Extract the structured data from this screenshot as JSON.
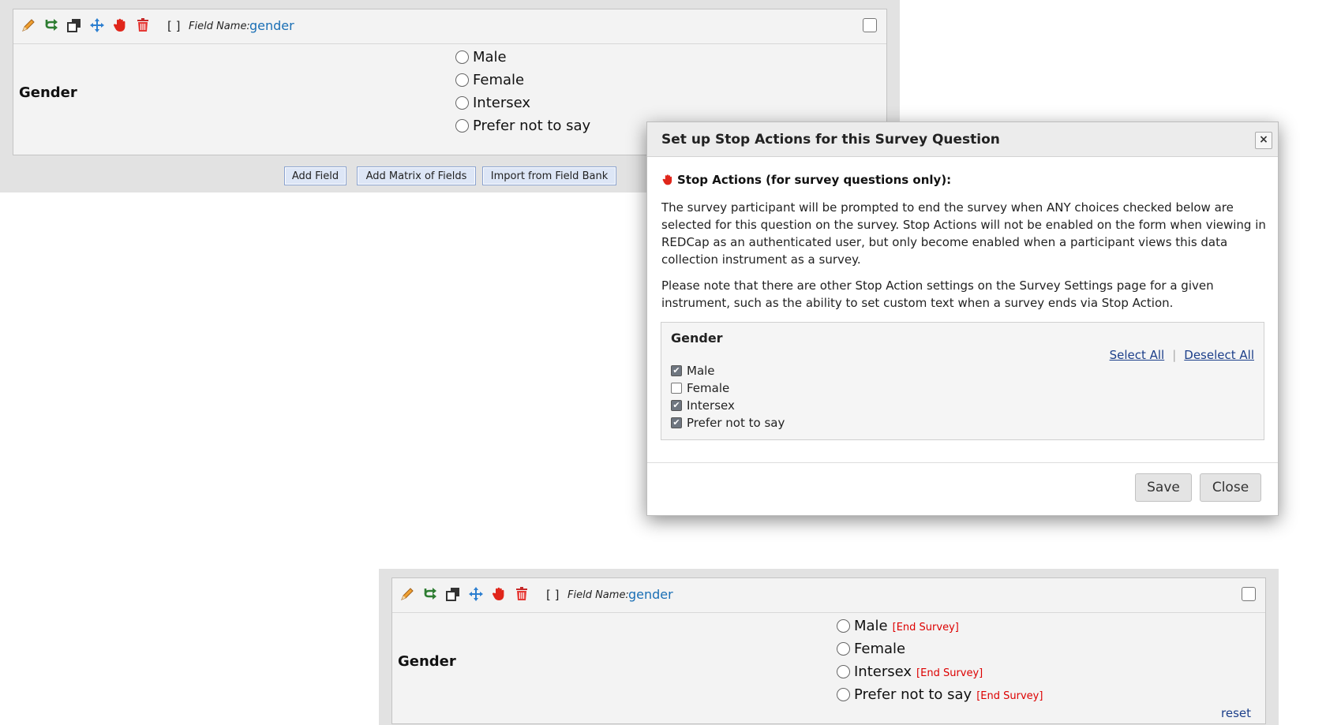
{
  "top_field": {
    "bracket": "[ ]",
    "field_name_label": "Field Name:",
    "field_name_value": "gender",
    "question_label": "Gender",
    "choices": [
      "Male",
      "Female",
      "Intersex",
      "Prefer not to say"
    ],
    "toolbar_icons": [
      "pencil-icon",
      "branch-icon",
      "copy-icon",
      "move-icon",
      "stop-hand-icon",
      "trash-icon"
    ],
    "buttons": {
      "add_field": "Add Field",
      "add_matrix": "Add Matrix of Fields",
      "import_bank": "Import from Field Bank"
    }
  },
  "dialog": {
    "title": "Set up Stop Actions for this Survey Question",
    "close_x": "×",
    "heading": "Stop Actions (for survey questions only):",
    "paragraph1": "The survey participant will be prompted to end the survey when ANY choices checked below are selected for this question on the survey. Stop Actions will not be enabled on the form when viewing in REDCap as an authenticated user, but only become enabled when a participant views this data collection instrument as a survey.",
    "paragraph2": "Please note that there are other Stop Action settings on the Survey Settings page for a given instrument, such as the ability to set custom text when a survey ends via Stop Action.",
    "choice_box_title": "Gender",
    "select_all": "Select All",
    "separator": "|",
    "deselect_all": "Deselect All",
    "options": [
      {
        "label": "Male",
        "checked": true
      },
      {
        "label": "Female",
        "checked": false
      },
      {
        "label": "Intersex",
        "checked": true
      },
      {
        "label": "Prefer not to say",
        "checked": true
      }
    ],
    "save_label": "Save",
    "close_label": "Close"
  },
  "bottom_field": {
    "bracket": "[ ]",
    "field_name_label": "Field Name:",
    "field_name_value": "gender",
    "question_label": "Gender",
    "choices": [
      {
        "label": "Male",
        "tag": "[End Survey]"
      },
      {
        "label": "Female",
        "tag": ""
      },
      {
        "label": "Intersex",
        "tag": "[End Survey]"
      },
      {
        "label": "Prefer not to say",
        "tag": "[End Survey]"
      }
    ],
    "reset_label": "reset"
  },
  "colors": {
    "link_blue": "#1a6fb5",
    "end_survey_red": "#dd0000",
    "panel_gray": "#e2e2e2"
  }
}
